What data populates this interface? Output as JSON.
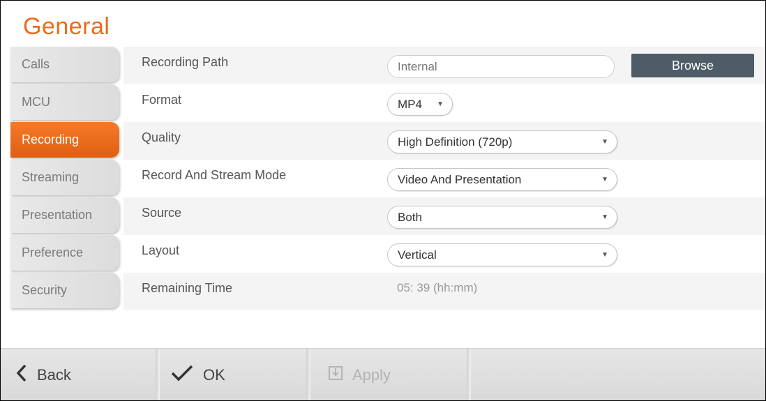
{
  "page": {
    "title": "General"
  },
  "sidebar": {
    "items": [
      {
        "label": "Calls",
        "active": false
      },
      {
        "label": "MCU",
        "active": false
      },
      {
        "label": "Recording",
        "active": true
      },
      {
        "label": "Streaming",
        "active": false
      },
      {
        "label": "Presentation",
        "active": false
      },
      {
        "label": "Preference",
        "active": false
      },
      {
        "label": "Security",
        "active": false
      }
    ]
  },
  "settings": {
    "recording_path": {
      "label": "Recording Path",
      "placeholder": "Internal",
      "browse_label": "Browse"
    },
    "format": {
      "label": "Format",
      "value": "MP4"
    },
    "quality": {
      "label": "Quality",
      "value": "High Definition (720p)"
    },
    "record_stream_mode": {
      "label": "Record And Stream Mode",
      "value": "Video And Presentation"
    },
    "source": {
      "label": "Source",
      "value": "Both"
    },
    "layout": {
      "label": "Layout",
      "value": "Vertical"
    },
    "remaining_time": {
      "label": "Remaining Time",
      "value": "05: 39  (hh:mm)"
    }
  },
  "footer": {
    "back_label": "Back",
    "ok_label": "OK",
    "apply_label": "Apply"
  },
  "colors": {
    "accent": "#ec6b1a",
    "browse_button": "#4d5c66",
    "row_shade": "#f4f4f4"
  },
  "icons": {
    "back": "chevron-left-icon",
    "ok": "checkmark-icon",
    "apply": "apply-icon",
    "dropdown": "chevron-down-icon"
  }
}
